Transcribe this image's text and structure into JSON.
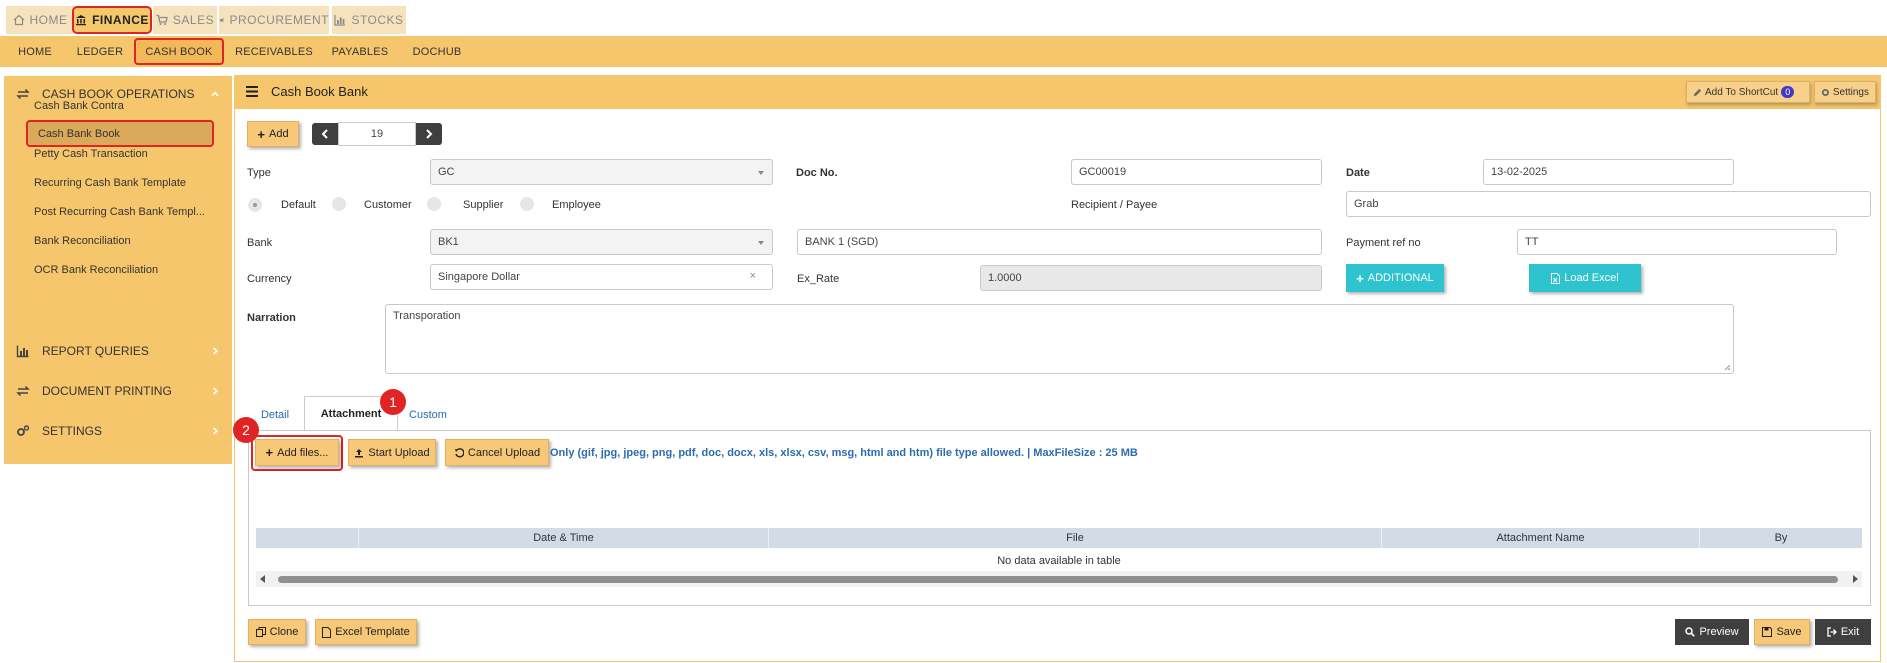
{
  "modules": [
    {
      "label": "HOME",
      "icon": "home-icon"
    },
    {
      "label": "FINANCE",
      "icon": "bank-icon",
      "active": true
    },
    {
      "label": "SALES",
      "icon": "cart-icon"
    },
    {
      "label": "PROCUREMENT",
      "icon": "megaphone-icon"
    },
    {
      "label": "STOCKS",
      "icon": "bar-chart-icon"
    }
  ],
  "subnav": [
    "HOME",
    "LEDGER",
    "CASH BOOK",
    "RECEIVABLES",
    "PAYABLES",
    "DOCHUB"
  ],
  "sidebar": {
    "sections": [
      {
        "label": "CASH BOOK OPERATIONS",
        "icon": "exchange-icon"
      },
      {
        "label": "REPORT QUERIES",
        "icon": "bar-chart-icon"
      },
      {
        "label": "DOCUMENT PRINTING",
        "icon": "exchange-icon"
      },
      {
        "label": "SETTINGS",
        "icon": "cogs-icon"
      }
    ],
    "items": [
      "Cash Bank Contra",
      "Cash Bank Book",
      "Petty Cash Transaction",
      "Recurring Cash Bank Template",
      "Post Recurring Cash Bank Templ...",
      "Bank Reconciliation",
      "OCR Bank Reconciliation"
    ],
    "active_item": "Cash Bank Book"
  },
  "page": {
    "title": "Cash Book Bank",
    "add_shortcut_label": "Add To ShortCut",
    "shortcut_count": "0",
    "settings_label": "Settings"
  },
  "toolbar": {
    "add_label": "Add",
    "record_number": "19"
  },
  "form": {
    "type_label": "Type",
    "type_value": "GC",
    "docno_label": "Doc No.",
    "docno_value": "GC00019",
    "date_label": "Date",
    "date_value": "13-02-2025",
    "radios": [
      "Default",
      "Customer",
      "Supplier",
      "Employee"
    ],
    "selected_radio": "Default",
    "recipient_label": "Recipient / Payee",
    "recipient_value": "Grab",
    "bank_label": "Bank",
    "bank_value": "BK1",
    "bank_name": "BANK 1 (SGD)",
    "payment_ref_label": "Payment ref no",
    "payment_ref_value": "TT",
    "currency_label": "Currency",
    "currency_value": "Singapore Dollar",
    "currency_clear": "×",
    "exrate_label": "Ex_Rate",
    "exrate_value": "1.0000",
    "additional_label": "ADDITIONAL",
    "load_excel_label": "Load Excel",
    "narration_label": "Narration",
    "narration_value": "Transporation"
  },
  "tabs": [
    "Detail",
    "Attachment",
    "Custom"
  ],
  "active_tab": "Attachment",
  "markers": [
    "1",
    "2"
  ],
  "attachment": {
    "add_files_label": "Add files...",
    "start_upload_label": "Start Upload",
    "cancel_upload_label": "Cancel Upload",
    "notice": "Only (gif, jpg, jpeg, png, pdf, doc, docx, xls, xlsx, csv, msg, html and htm) file type allowed. | MaxFileSize : 25 MB",
    "columns": [
      "",
      "Date & Time",
      "File",
      "Attachment Name",
      "By"
    ],
    "empty_message": "No data available in table"
  },
  "footer": {
    "clone_label": "Clone",
    "excel_template_label": "Excel Template",
    "preview_label": "Preview",
    "save_label": "Save",
    "exit_label": "Exit"
  },
  "colors": {
    "accent": "#f6c66c",
    "highlight": "#e02424",
    "teal": "#2ec4cf",
    "dark": "#3f3f3f"
  }
}
